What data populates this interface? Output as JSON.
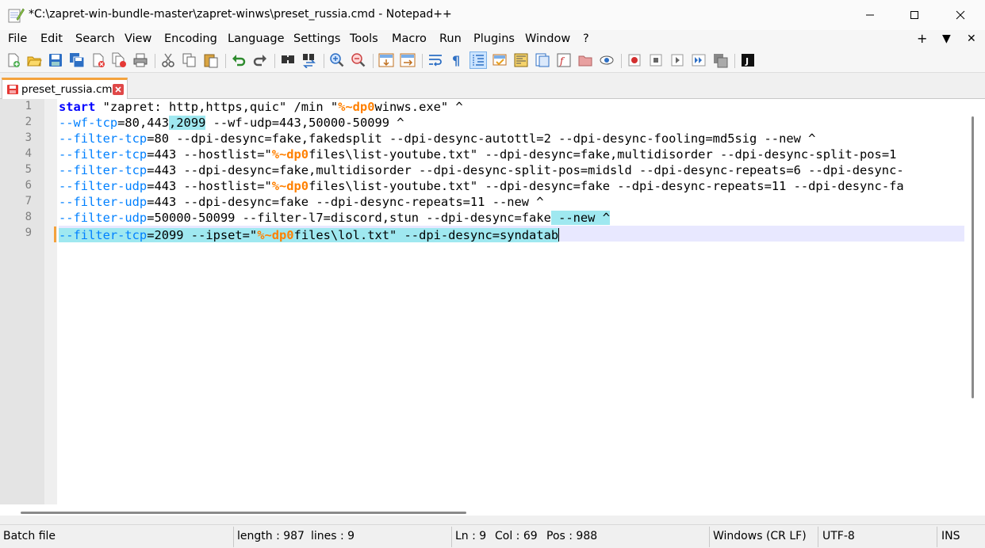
{
  "window": {
    "title": "*C:\\zapret-win-bundle-master\\zapret-winws\\preset_russia.cmd - Notepad++"
  },
  "menu": {
    "items": [
      "File",
      "Edit",
      "Search",
      "View",
      "Encoding",
      "Language",
      "Settings",
      "Tools",
      "Macro",
      "Run",
      "Plugins",
      "Window",
      "?"
    ],
    "right": [
      "+",
      "▼",
      "✕"
    ]
  },
  "toolbar": {
    "icons": [
      "new-file-icon",
      "open-file-icon",
      "save-icon",
      "save-all-icon",
      "close-icon",
      "close-all-icon",
      "print-icon",
      "cut-icon",
      "copy-icon",
      "paste-icon",
      "undo-icon",
      "redo-icon",
      "find-icon",
      "replace-icon",
      "zoom-in-icon",
      "zoom-out-icon",
      "sync-vertical-icon",
      "sync-horizontal-icon",
      "word-wrap-icon",
      "show-all-chars-icon",
      "indent-guide-icon",
      "udl-icon",
      "doc-map-icon",
      "doc-list-icon",
      "function-list-icon",
      "folder-workspace-icon",
      "monitoring-icon",
      "record-macro-icon",
      "stop-macro-icon",
      "play-macro-icon",
      "run-macro-multiple-icon",
      "save-macro-icon",
      "j-plugin-icon"
    ]
  },
  "tab": {
    "label": "preset_russia.cmd"
  },
  "editor": {
    "line_numbers": [
      "1",
      "2",
      "3",
      "4",
      "5",
      "6",
      "7",
      "8",
      "9"
    ],
    "lines": [
      [
        {
          "t": "start",
          "c": "kw"
        },
        {
          "t": " \"zapret: http,https,quic\" /min \""
        },
        {
          "t": "%~dp0",
          "c": "var"
        },
        {
          "t": "winws.exe\" ^"
        }
      ],
      [
        {
          "t": "--wf-tcp",
          "c": "opt"
        },
        {
          "t": "=80,443"
        },
        {
          "t": ",2099",
          "c": "sel"
        },
        {
          "t": " --wf-udp=443,50000-50099 ^"
        }
      ],
      [
        {
          "t": "--filter-tcp",
          "c": "opt"
        },
        {
          "t": "=80 --dpi-desync=fake,fakedsplit --dpi-desync-autottl=2 --dpi-desync-fooling=md5sig --new ^"
        }
      ],
      [
        {
          "t": "--filter-tcp",
          "c": "opt"
        },
        {
          "t": "=443 --hostlist=\""
        },
        {
          "t": "%~dp0",
          "c": "var"
        },
        {
          "t": "files\\list-youtube.txt\" --dpi-desync=fake,multidisorder --dpi-desync-split-pos=1"
        }
      ],
      [
        {
          "t": "--filter-tcp",
          "c": "opt"
        },
        {
          "t": "=443 --dpi-desync=fake,multidisorder --dpi-desync-split-pos=midsld --dpi-desync-repeats=6 --dpi-desync-"
        }
      ],
      [
        {
          "t": "--filter-udp",
          "c": "opt"
        },
        {
          "t": "=443 --hostlist=\""
        },
        {
          "t": "%~dp0",
          "c": "var"
        },
        {
          "t": "files\\list-youtube.txt\" --dpi-desync=fake --dpi-desync-repeats=11 --dpi-desync-fa"
        }
      ],
      [
        {
          "t": "--filter-udp",
          "c": "opt"
        },
        {
          "t": "=443 --dpi-desync=fake --dpi-desync-repeats=11 --new ^"
        }
      ],
      [
        {
          "t": "--filter-udp",
          "c": "opt"
        },
        {
          "t": "=50000-50099 --filter-l7=discord,stun --dpi-desync=fake"
        },
        {
          "t": " --new ^",
          "c": "sel"
        }
      ],
      [
        {
          "t": "--filter-tcp",
          "c": "opt sel"
        },
        {
          "t": "=2099 --ipset=\"",
          "c": "sel"
        },
        {
          "t": "%~dp0",
          "c": "var sel"
        },
        {
          "t": "files\\lol.txt\" --dpi-desync=syndatab",
          "c": "sel"
        }
      ]
    ]
  },
  "status": {
    "language": "Batch file",
    "length": "length : 987",
    "lines": "lines : 9",
    "ln": "Ln : 9",
    "col": "Col : 69",
    "pos": "Pos : 988",
    "eol": "Windows (CR LF)",
    "encoding": "UTF-8",
    "mode": "INS"
  }
}
